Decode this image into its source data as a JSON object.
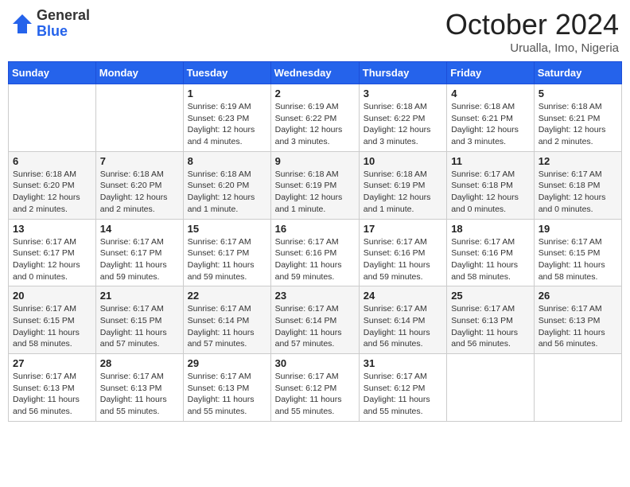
{
  "header": {
    "logo_general": "General",
    "logo_blue": "Blue",
    "month_title": "October 2024",
    "location": "Urualla, Imo, Nigeria"
  },
  "days_of_week": [
    "Sunday",
    "Monday",
    "Tuesday",
    "Wednesday",
    "Thursday",
    "Friday",
    "Saturday"
  ],
  "weeks": [
    [
      {
        "day": "",
        "info": ""
      },
      {
        "day": "",
        "info": ""
      },
      {
        "day": "1",
        "info": "Sunrise: 6:19 AM\nSunset: 6:23 PM\nDaylight: 12 hours and 4 minutes."
      },
      {
        "day": "2",
        "info": "Sunrise: 6:19 AM\nSunset: 6:22 PM\nDaylight: 12 hours and 3 minutes."
      },
      {
        "day": "3",
        "info": "Sunrise: 6:18 AM\nSunset: 6:22 PM\nDaylight: 12 hours and 3 minutes."
      },
      {
        "day": "4",
        "info": "Sunrise: 6:18 AM\nSunset: 6:21 PM\nDaylight: 12 hours and 3 minutes."
      },
      {
        "day": "5",
        "info": "Sunrise: 6:18 AM\nSunset: 6:21 PM\nDaylight: 12 hours and 2 minutes."
      }
    ],
    [
      {
        "day": "6",
        "info": "Sunrise: 6:18 AM\nSunset: 6:20 PM\nDaylight: 12 hours and 2 minutes."
      },
      {
        "day": "7",
        "info": "Sunrise: 6:18 AM\nSunset: 6:20 PM\nDaylight: 12 hours and 2 minutes."
      },
      {
        "day": "8",
        "info": "Sunrise: 6:18 AM\nSunset: 6:20 PM\nDaylight: 12 hours and 1 minute."
      },
      {
        "day": "9",
        "info": "Sunrise: 6:18 AM\nSunset: 6:19 PM\nDaylight: 12 hours and 1 minute."
      },
      {
        "day": "10",
        "info": "Sunrise: 6:18 AM\nSunset: 6:19 PM\nDaylight: 12 hours and 1 minute."
      },
      {
        "day": "11",
        "info": "Sunrise: 6:17 AM\nSunset: 6:18 PM\nDaylight: 12 hours and 0 minutes."
      },
      {
        "day": "12",
        "info": "Sunrise: 6:17 AM\nSunset: 6:18 PM\nDaylight: 12 hours and 0 minutes."
      }
    ],
    [
      {
        "day": "13",
        "info": "Sunrise: 6:17 AM\nSunset: 6:17 PM\nDaylight: 12 hours and 0 minutes."
      },
      {
        "day": "14",
        "info": "Sunrise: 6:17 AM\nSunset: 6:17 PM\nDaylight: 11 hours and 59 minutes."
      },
      {
        "day": "15",
        "info": "Sunrise: 6:17 AM\nSunset: 6:17 PM\nDaylight: 11 hours and 59 minutes."
      },
      {
        "day": "16",
        "info": "Sunrise: 6:17 AM\nSunset: 6:16 PM\nDaylight: 11 hours and 59 minutes."
      },
      {
        "day": "17",
        "info": "Sunrise: 6:17 AM\nSunset: 6:16 PM\nDaylight: 11 hours and 59 minutes."
      },
      {
        "day": "18",
        "info": "Sunrise: 6:17 AM\nSunset: 6:16 PM\nDaylight: 11 hours and 58 minutes."
      },
      {
        "day": "19",
        "info": "Sunrise: 6:17 AM\nSunset: 6:15 PM\nDaylight: 11 hours and 58 minutes."
      }
    ],
    [
      {
        "day": "20",
        "info": "Sunrise: 6:17 AM\nSunset: 6:15 PM\nDaylight: 11 hours and 58 minutes."
      },
      {
        "day": "21",
        "info": "Sunrise: 6:17 AM\nSunset: 6:15 PM\nDaylight: 11 hours and 57 minutes."
      },
      {
        "day": "22",
        "info": "Sunrise: 6:17 AM\nSunset: 6:14 PM\nDaylight: 11 hours and 57 minutes."
      },
      {
        "day": "23",
        "info": "Sunrise: 6:17 AM\nSunset: 6:14 PM\nDaylight: 11 hours and 57 minutes."
      },
      {
        "day": "24",
        "info": "Sunrise: 6:17 AM\nSunset: 6:14 PM\nDaylight: 11 hours and 56 minutes."
      },
      {
        "day": "25",
        "info": "Sunrise: 6:17 AM\nSunset: 6:13 PM\nDaylight: 11 hours and 56 minutes."
      },
      {
        "day": "26",
        "info": "Sunrise: 6:17 AM\nSunset: 6:13 PM\nDaylight: 11 hours and 56 minutes."
      }
    ],
    [
      {
        "day": "27",
        "info": "Sunrise: 6:17 AM\nSunset: 6:13 PM\nDaylight: 11 hours and 56 minutes."
      },
      {
        "day": "28",
        "info": "Sunrise: 6:17 AM\nSunset: 6:13 PM\nDaylight: 11 hours and 55 minutes."
      },
      {
        "day": "29",
        "info": "Sunrise: 6:17 AM\nSunset: 6:13 PM\nDaylight: 11 hours and 55 minutes."
      },
      {
        "day": "30",
        "info": "Sunrise: 6:17 AM\nSunset: 6:12 PM\nDaylight: 11 hours and 55 minutes."
      },
      {
        "day": "31",
        "info": "Sunrise: 6:17 AM\nSunset: 6:12 PM\nDaylight: 11 hours and 55 minutes."
      },
      {
        "day": "",
        "info": ""
      },
      {
        "day": "",
        "info": ""
      }
    ]
  ]
}
